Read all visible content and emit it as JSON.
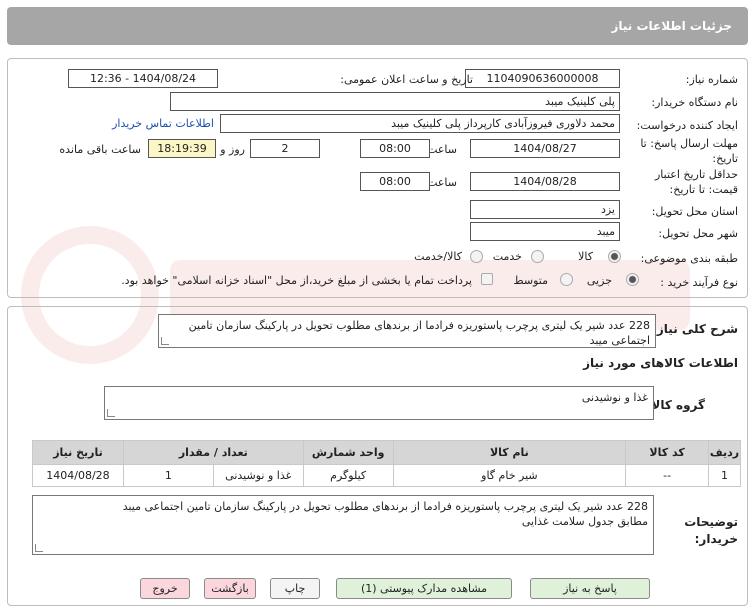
{
  "header": {
    "title": "جزئیات اطلاعات نیاز"
  },
  "form": {
    "need_number_label": "شماره نیاز:",
    "need_number": "1104090636000008",
    "announce_label": "تاریخ و ساعت اعلان عمومی:",
    "announce_value": "1404/08/24 - 12:36",
    "buyer_org_label": "نام دستگاه خریدار:",
    "buyer_org": "پلی کلینیک میبد",
    "creator_label": "ایجاد کننده درخواست:",
    "creator": "محمد دلاوری فیروزآبادی کارپرداز پلی کلینیک میبد",
    "contact_link": "اطلاعات تماس خریدار",
    "deadline_label": "مهلت ارسال پاسخ: تا تاریخ:",
    "deadline_date": "1404/08/27",
    "time_label": "ساعت",
    "deadline_time": "08:00",
    "days_value": "2",
    "days_label": "روز و",
    "remaining_time": "18:19:39",
    "remaining_label": "ساعت باقی مانده",
    "validity_label": "حداقل تاریخ اعتبار قیمت: تا تاریخ:",
    "validity_date": "1404/08/28",
    "validity_time": "08:00",
    "province_label": "استان محل تحویل:",
    "province": "یزد",
    "city_label": "شهر محل تحویل:",
    "city": "میبد",
    "category_label": "طبقه بندی موضوعی:",
    "category_options": [
      "کالا",
      "خدمت",
      "کالا/خدمت"
    ],
    "category_selected": 0,
    "process_label": "نوع فرآیند خرید :",
    "process_options": [
      "جزیی",
      "متوسط"
    ],
    "process_selected": 0,
    "payment_note": "پرداخت تمام یا بخشی از مبلغ خرید،از محل \"اسناد خزانه اسلامی\" خواهد بود."
  },
  "details": {
    "summary_label": "شرح کلی نیاز:",
    "summary": "228 عدد شیر یک لیتری پرچرب پاستوریزه فرادما از برندهای مطلوب تحویل در پارکینگ سازمان تامین اجتماعی میبد",
    "goods_info_title": "اطلاعات کالاهای مورد نیاز",
    "group_label": "گروه کالا:",
    "group_value": "غذا و نوشیدنی",
    "table": {
      "headers": [
        "ردیف",
        "کد کالا",
        "نام کالا",
        "واحد شمارش",
        "تعداد / مقدار",
        "تاریخ نیاز"
      ],
      "rows": [
        [
          "1",
          "--",
          "شیر خام گاو",
          "کیلوگرم",
          "غذا و نوشیدنی",
          "1",
          "1404/08/28"
        ]
      ]
    },
    "buyer_notes_label": "توضیحات خریدار:",
    "buyer_notes_line1": "228 عدد شیر یک لیتری پرچرب پاستوریزه فرادما از برندهای مطلوب تحویل در پارکینگ سازمان تامین اجتماعی میبد",
    "buyer_notes_line2": "مطابق جدول سلامت غذایی"
  },
  "buttons": {
    "reply": "پاسخ به نیاز",
    "view_docs": "مشاهده مدارک پیوستی (1)",
    "print": "چاپ",
    "back": "بازگشت",
    "exit": "خروج"
  },
  "colors": {
    "header_bg": "#a6a6a6",
    "link": "#1c4fb4",
    "remaining_bg": "#fbf6c6",
    "button_green": "#dff1d8",
    "button_pink": "#fbd6dc"
  }
}
